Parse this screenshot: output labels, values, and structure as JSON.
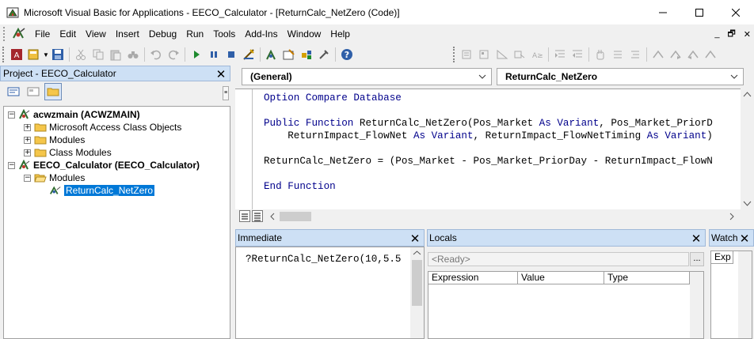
{
  "window": {
    "title": "Microsoft Visual Basic for Applications - EECO_Calculator - [ReturnCalc_NetZero (Code)]",
    "minimize": "—",
    "maximize": "☐",
    "close": "✕"
  },
  "menu": {
    "items": [
      "File",
      "Edit",
      "View",
      "Insert",
      "Debug",
      "Run",
      "Tools",
      "Add-Ins",
      "Window",
      "Help"
    ],
    "mdi_minimize": "_",
    "mdi_restore": "🗗",
    "mdi_close": "✕"
  },
  "project": {
    "title": "Project - EECO_Calculator",
    "close": "✕",
    "tree": [
      {
        "label": "acwzmain (ACWZMAIN)",
        "expander": "−",
        "icon": "vba-project-icon"
      },
      {
        "label": "Microsoft Access Class Objects",
        "expander": "+",
        "icon": "folder-icon"
      },
      {
        "label": "Modules",
        "expander": "+",
        "icon": "folder-icon"
      },
      {
        "label": "Class Modules",
        "expander": "+",
        "icon": "folder-icon"
      },
      {
        "label": "EECO_Calculator (EECO_Calculator)",
        "expander": "−",
        "icon": "vba-project-icon"
      },
      {
        "label": "Modules",
        "expander": "−",
        "icon": "folder-open-icon"
      },
      {
        "label": "ReturnCalc_NetZero",
        "icon": "module-icon"
      }
    ]
  },
  "code": {
    "object_combo": "(General)",
    "proc_combo": "ReturnCalc_NetZero",
    "lines": [
      [
        {
          "t": "Option Compare Database",
          "kw": true
        }
      ],
      [],
      [
        {
          "t": "Public Function",
          "kw": true
        },
        {
          "t": " ReturnCalc_NetZero(Pos_Market "
        },
        {
          "t": "As Variant",
          "kw": true
        },
        {
          "t": ", Pos_Market_PriorD"
        }
      ],
      [
        {
          "t": "    ReturnImpact_FlowNet "
        },
        {
          "t": "As Variant",
          "kw": true
        },
        {
          "t": ", ReturnImpact_FlowNetTiming "
        },
        {
          "t": "As Variant",
          "kw": true
        },
        {
          "t": ")"
        }
      ],
      [],
      [
        {
          "t": "ReturnCalc_NetZero = (Pos_Market - Pos_Market_PriorDay - ReturnImpact_FlowN"
        }
      ],
      [],
      [
        {
          "t": "End Function",
          "kw": true
        }
      ]
    ]
  },
  "immediate": {
    "title": "Immediate",
    "close": "✕",
    "text": "?ReturnCalc_NetZero(10,5.5"
  },
  "locals": {
    "title": "Locals",
    "close": "✕",
    "ready": "<Ready>",
    "ellipsis": "...",
    "columns": [
      "Expression",
      "Value",
      "Type"
    ]
  },
  "watch": {
    "title": "Watch",
    "close": "✕",
    "column": "Exp"
  }
}
